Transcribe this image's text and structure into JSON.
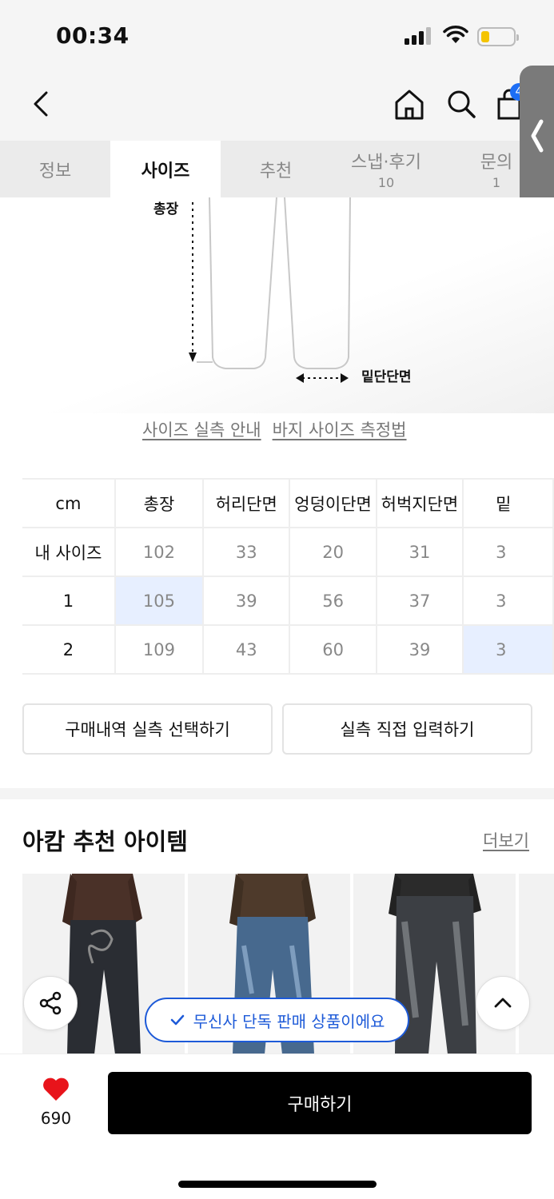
{
  "status_bar": {
    "time": "00:34"
  },
  "header": {
    "cart_count": "4"
  },
  "tabs": [
    {
      "label": "정보",
      "count": ""
    },
    {
      "label": "사이즈",
      "count": ""
    },
    {
      "label": "추천",
      "count": ""
    },
    {
      "label": "스냅·후기",
      "count": "10"
    },
    {
      "label": "문의",
      "count": "1"
    }
  ],
  "diagram": {
    "total_length_label": "총장",
    "hem_label": "밑단단면"
  },
  "guide_links": {
    "actual_size": "사이즈 실측 안내",
    "measure_method": "바지 사이즈 측정법"
  },
  "size_table": {
    "headers": [
      "cm",
      "총장",
      "허리단면",
      "엉덩이단면",
      "허벅지단면",
      "밑"
    ],
    "rows": [
      [
        "내 사이즈",
        "102",
        "33",
        "20",
        "31",
        "3"
      ],
      [
        "1",
        "105",
        "39",
        "56",
        "37",
        "3"
      ],
      [
        "2",
        "109",
        "43",
        "60",
        "39",
        "3"
      ]
    ]
  },
  "buttons": {
    "select_purchase": "구매내역 실측 선택하기",
    "direct_input": "실측 직접 입력하기"
  },
  "recommend": {
    "title": "아캄 추천 아이템",
    "more": "더보기"
  },
  "exclusive_badge": "무신사 단독 판매 상품이에요",
  "bottom_bar": {
    "like_count": "690",
    "buy_label": "구매하기"
  },
  "colors": {
    "accent_blue": "#1d5ad8",
    "highlight_cell": "#e7efff",
    "heart_red": "#e8141b"
  }
}
